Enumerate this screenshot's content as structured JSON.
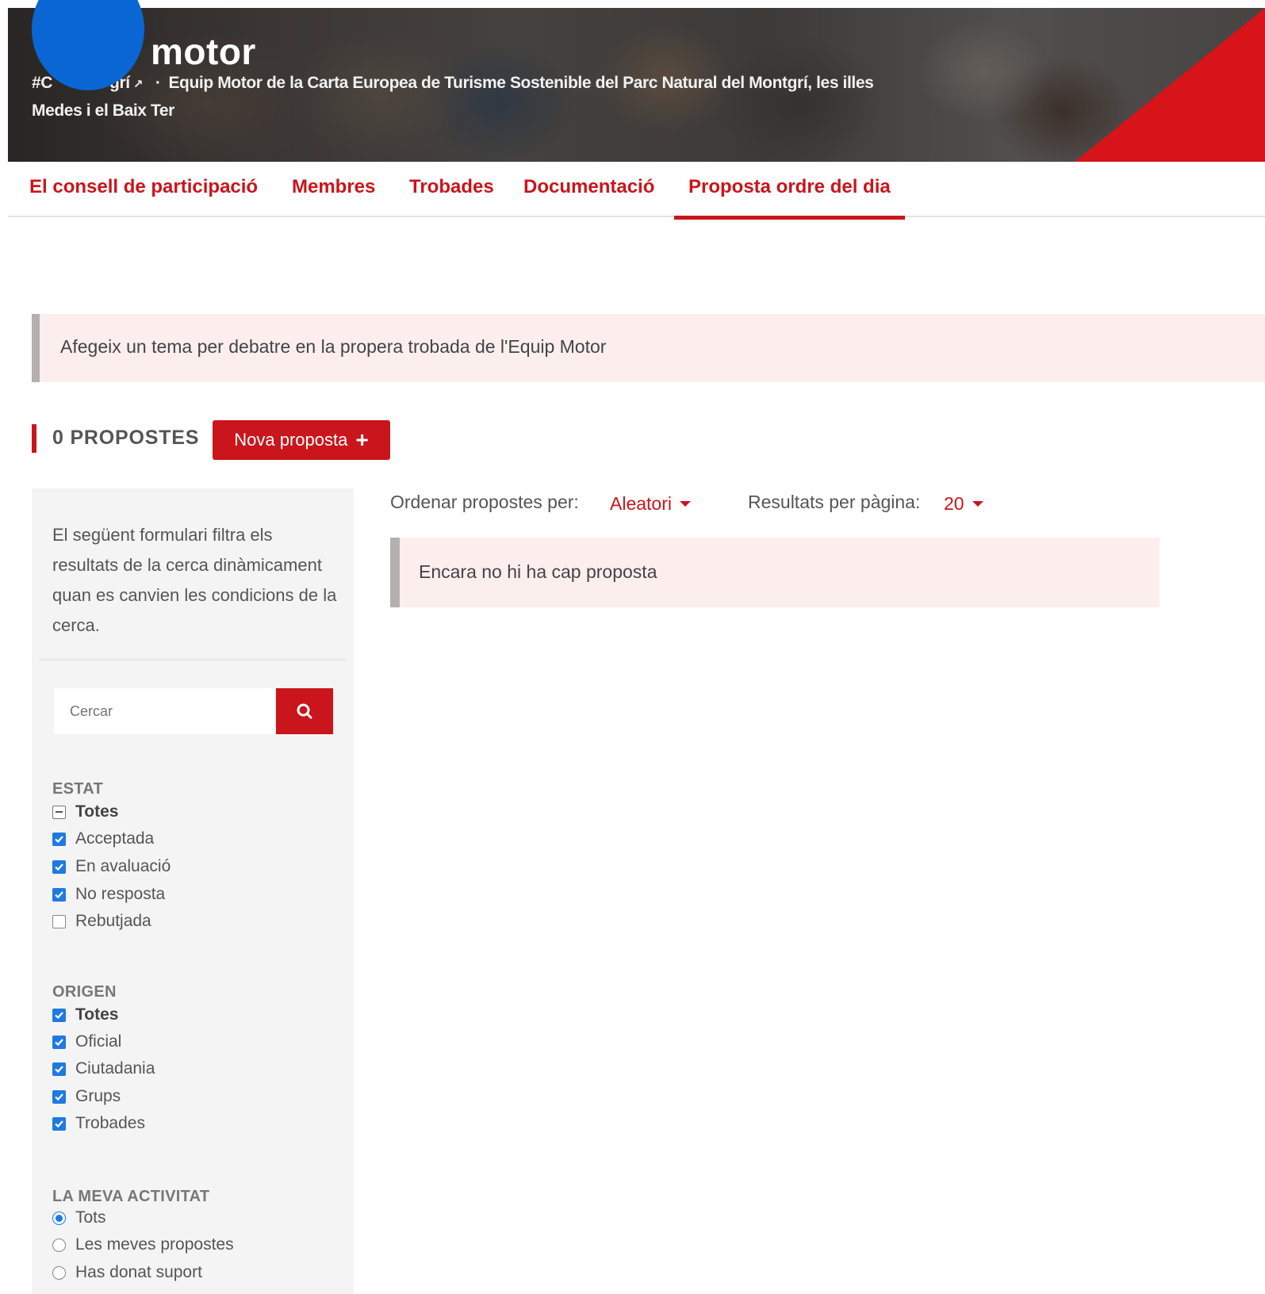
{
  "header": {
    "title": "motor",
    "hashtag": "#C",
    "hashtag_tail": "grí",
    "external_icon": "external-link-icon",
    "separator": "·",
    "subtitle": "Equip Motor de la Carta Europea de Turisme Sostenible del Parc Natural del Montgrí, les illes Medes i el Baix Ter",
    "brand_color": "#d7141a",
    "logo_color": "#0a66d2"
  },
  "tabs": [
    {
      "label": "El consell de participació",
      "active": false
    },
    {
      "label": "Membres",
      "active": false
    },
    {
      "label": "Trobades",
      "active": false
    },
    {
      "label": "Documentació",
      "active": false
    },
    {
      "label": "Proposta ordre del dia",
      "active": true
    }
  ],
  "callout": {
    "text": "Afegeix un tema per debatre en la propera trobada de l'Equip Motor"
  },
  "proposals": {
    "count_label": "0 PROPOSTES",
    "new_button_label": "Nova proposta",
    "new_button_icon": "plus-icon"
  },
  "sidebar": {
    "intro": "El següent formulari filtra els resultats de la cerca dinàmicament quan es canvien les condicions de la cerca.",
    "search": {
      "placeholder": "Cercar",
      "value": "",
      "button_icon": "search-icon"
    },
    "estat": {
      "title": "ESTAT",
      "items": [
        {
          "label": "Totes",
          "state": "partial"
        },
        {
          "label": "Acceptada",
          "state": "checked"
        },
        {
          "label": "En avaluació",
          "state": "checked"
        },
        {
          "label": "No resposta",
          "state": "checked"
        },
        {
          "label": "Rebutjada",
          "state": "unchecked"
        }
      ]
    },
    "origen": {
      "title": "ORIGEN",
      "items": [
        {
          "label": "Totes",
          "state": "checked"
        },
        {
          "label": "Oficial",
          "state": "checked"
        },
        {
          "label": "Ciutadania",
          "state": "checked"
        },
        {
          "label": "Grups",
          "state": "checked"
        },
        {
          "label": "Trobades",
          "state": "checked"
        }
      ]
    },
    "activitat": {
      "title": "LA MEVA ACTIVITAT",
      "items": [
        {
          "label": "Tots",
          "selected": true
        },
        {
          "label": "Les meves propostes",
          "selected": false
        },
        {
          "label": "Has donat suport",
          "selected": false
        }
      ]
    }
  },
  "main": {
    "sort_label": "Ordenar propostes per:",
    "sort_value": "Aleatori",
    "per_page_label": "Resultats per pàgina:",
    "per_page_value": "20",
    "empty_message": "Encara no hi ha cap proposta"
  }
}
